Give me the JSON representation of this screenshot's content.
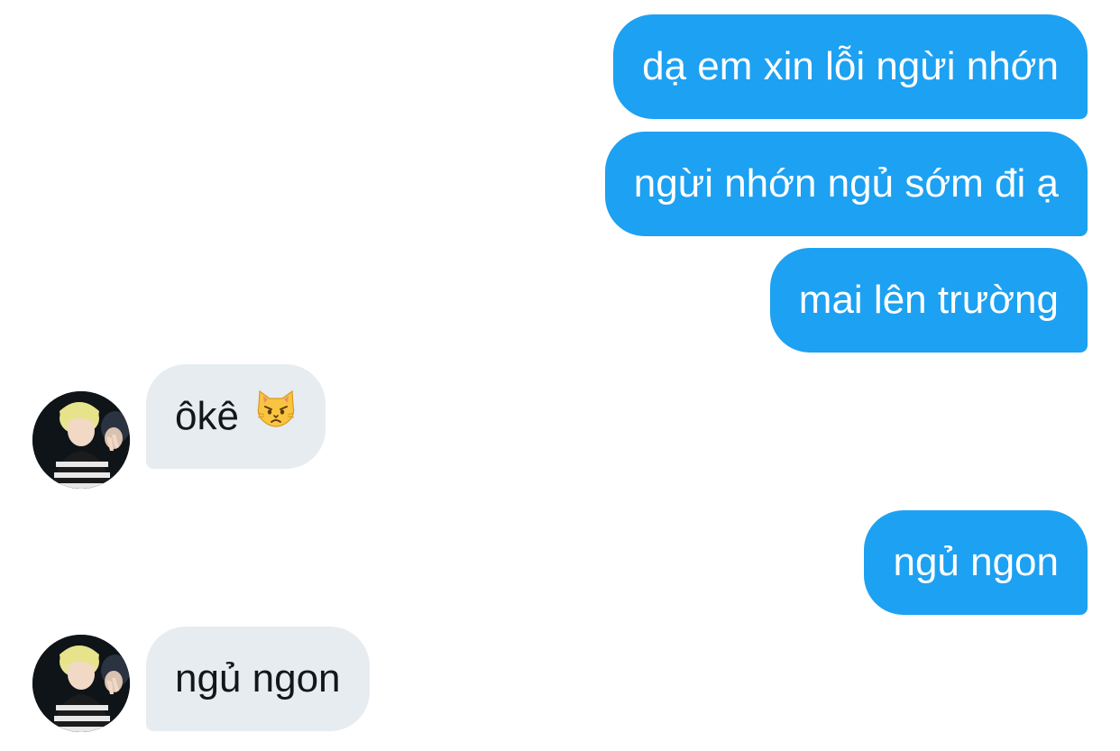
{
  "conversation": {
    "messages": [
      {
        "direction": "sent",
        "text": "dạ em xin lỗi ngừi nhớn"
      },
      {
        "direction": "sent",
        "text": "ngừi nhớn ngủ sớm đi ạ"
      },
      {
        "direction": "sent",
        "text": "mai lên trường"
      },
      {
        "direction": "received",
        "text": "ôkê",
        "emoji": "pouting-cat-face"
      },
      {
        "direction": "sent",
        "text": "ngủ ngon"
      },
      {
        "direction": "received",
        "text": "ngủ ngon"
      }
    ]
  },
  "colors": {
    "sent_bubble": "#1DA1F2",
    "received_bubble": "#E6ECF0",
    "sent_text": "#FFFFFF",
    "received_text": "#14171A",
    "background": "#FFFFFF"
  },
  "icons": {
    "avatar": "user-avatar-photo",
    "emoji": "pouting-cat-face"
  }
}
